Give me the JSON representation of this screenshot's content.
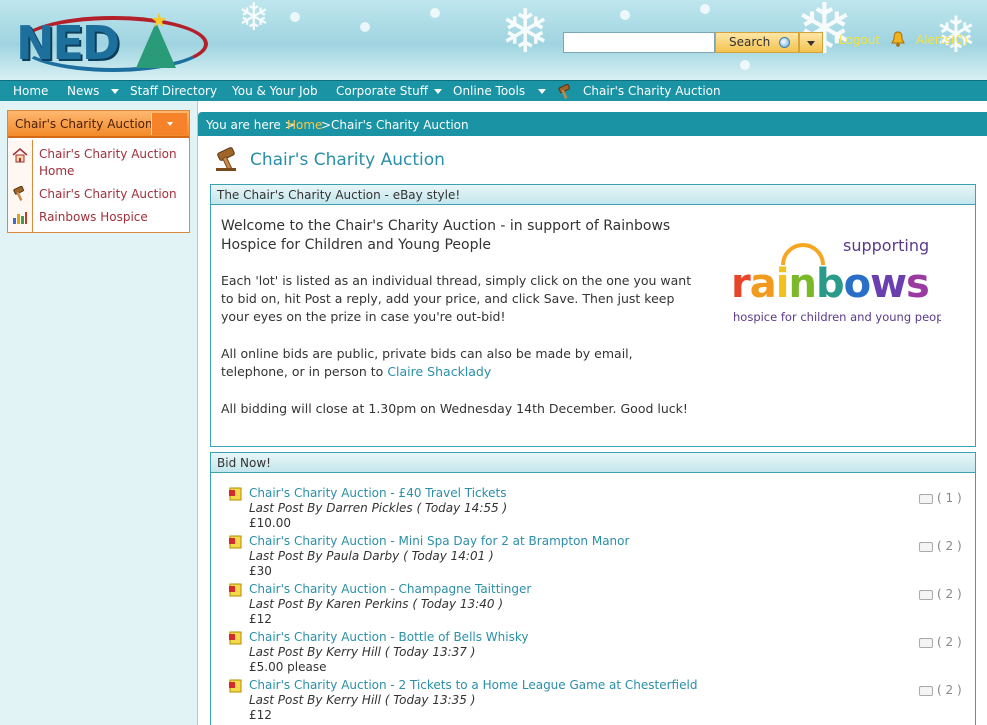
{
  "header": {
    "logo_text": "NED",
    "search": {
      "placeholder": "",
      "button_label": "Search"
    },
    "logout_label": "Logout",
    "alerts_label": "Alerts(0)"
  },
  "nav": {
    "items": [
      "Home",
      "News",
      "Staff Directory",
      "You & Your Job",
      "Corporate Stuff",
      "Online Tools",
      "Chair's Charity Auction"
    ]
  },
  "sidebar": {
    "title": "Chair's Charity Auction",
    "links": [
      {
        "label": "Chair's Charity Auction Home",
        "icon": "home-icon"
      },
      {
        "label": "Chair's Charity Auction",
        "icon": "gavel-icon"
      },
      {
        "label": "Rainbows Hospice",
        "icon": "chart-icon"
      }
    ]
  },
  "breadcrumb": {
    "prefix": "You are here >",
    "home": "Home",
    "separator": ">",
    "current": "Chair's Charity Auction"
  },
  "page_title": "Chair's Charity Auction",
  "intro": {
    "header": "The Chair's Charity Auction - eBay style!",
    "welcome": "Welcome to the Chair's Charity Auction - in support of Rainbows Hospice for Children and Young People",
    "para1": "Each 'lot' is listed as an individual thread, simply click on the one you want to bid on, hit Post a reply, add your price, and click Save. Then just keep your eyes on the prize in case you're out-bid!",
    "para2_prefix": "All online bids are public, private bids can also be made by email, telephone, or in person to",
    "para2_link": "Claire Shacklady",
    "para3": "All bidding will close at 1.30pm on Wednesday 14th December. Good luck!",
    "logo": {
      "top": "supporting",
      "word": "rainbows",
      "tagline": "hospice for children and young people"
    }
  },
  "bid_now": {
    "header": "Bid Now!",
    "lots": [
      {
        "title": "Chair's Charity Auction - £40 Travel Tickets",
        "last_post": "Last Post By Darren Pickles ( Today 14:55 )",
        "price": "£10.00",
        "replies": "( 1 )"
      },
      {
        "title": "Chair's Charity Auction - Mini Spa Day for 2 at Brampton Manor",
        "last_post": "Last Post By Paula Darby ( Today 14:01 )",
        "price": "£30",
        "replies": "( 2 )"
      },
      {
        "title": "Chair's Charity Auction - Champagne Taittinger",
        "last_post": "Last Post By Karen Perkins ( Today 13:40 )",
        "price": "£12",
        "replies": "( 2 )"
      },
      {
        "title": "Chair's Charity Auction - Bottle of Bells Whisky",
        "last_post": "Last Post By Kerry Hill ( Today 13:37 )",
        "price": "£5.00 please",
        "replies": "( 2 )"
      },
      {
        "title": "Chair's Charity Auction - 2 Tickets to a Home League Game at Chesterfield",
        "last_post": "Last Post By Kerry Hill ( Today 13:35 )",
        "price": "£12",
        "replies": "( 2 )"
      }
    ]
  },
  "colors": {
    "teal": "#1a93a5",
    "orange": "#f28a2a",
    "link": "#2a8fa8",
    "alert_yellow": "#f6e23a",
    "side_link": "#a0303a"
  }
}
